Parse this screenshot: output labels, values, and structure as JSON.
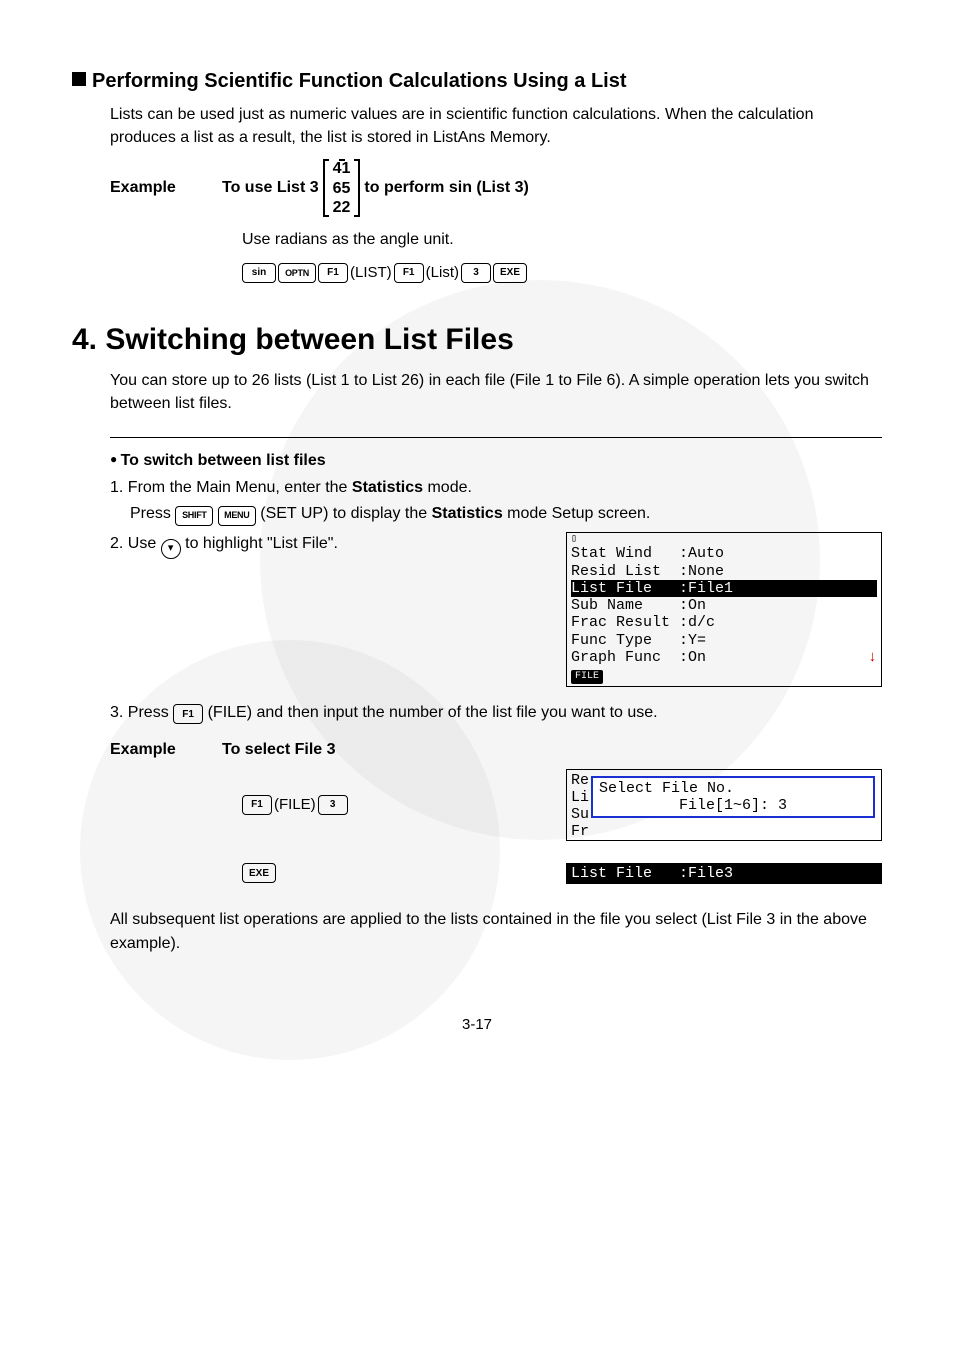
{
  "section1": {
    "heading": "Performing Scientific Function Calculations Using a List",
    "intro": "Lists can be used just as numeric values are in scientific function calculations. When the calculation produces a list as a result, the list is stored in ListAns Memory.",
    "example_label": "Example",
    "example_prefix": "To use List 3",
    "matrix": [
      "41",
      "65",
      "22"
    ],
    "example_suffix": "to perform sin (List 3)",
    "note": "Use radians as the angle unit.",
    "keys": {
      "sin": "sin",
      "optn": "OPTN",
      "f1": "F1",
      "ann_list_caps": "(LIST)",
      "ann_list": "(List)",
      "three": "3",
      "exe": "EXE"
    }
  },
  "section2": {
    "heading": "4. Switching between List Files",
    "intro": "You can store up to 26 lists (List 1 to List 26) in each file (File 1 to File 6). A simple operation lets you switch between list files.",
    "sub_heading": "To switch between list files",
    "step1_a": "1. From the Main Menu, enter the ",
    "step1_b": "Statistics",
    "step1_c": " mode.",
    "step1_sub_a": "Press ",
    "shift": "SHIFT",
    "menu": "MENU",
    "step1_sub_b": " (SET UP) to display the ",
    "step1_sub_c": "Statistics",
    "step1_sub_d": " mode Setup screen.",
    "step2_a": "2. Use ",
    "step2_b": " to highlight \"List File\".",
    "screen1": {
      "rows": [
        "Stat Wind   :Auto",
        "Resid List  :None",
        "List File   :File1",
        "Sub Name    :On",
        "Frac Result :d/c",
        "Func Type   :Y=",
        "Graph Func  :On"
      ],
      "highlight_row_index": 2,
      "tab": "FILE",
      "arrow": "↓"
    },
    "step3_a": "3. Press ",
    "f1": "F1",
    "step3_b": " (FILE) and then input the number of the list file you want to use.",
    "example_label": "Example",
    "example_text": "To select File 3",
    "keyseq1": {
      "f1": "F1",
      "ann": "(FILE)",
      "three": "3"
    },
    "dialog": {
      "bg": "Re\nLi\nSu\nFr\nFu",
      "title": "Select File No.",
      "prompt": "File[1~6]: 3"
    },
    "exe": "EXE",
    "result_bar": "List File   :File3",
    "outro": "All subsequent list operations are applied to the lists contained in the file you select (List File 3 in the above example)."
  },
  "page_number": "3-17"
}
